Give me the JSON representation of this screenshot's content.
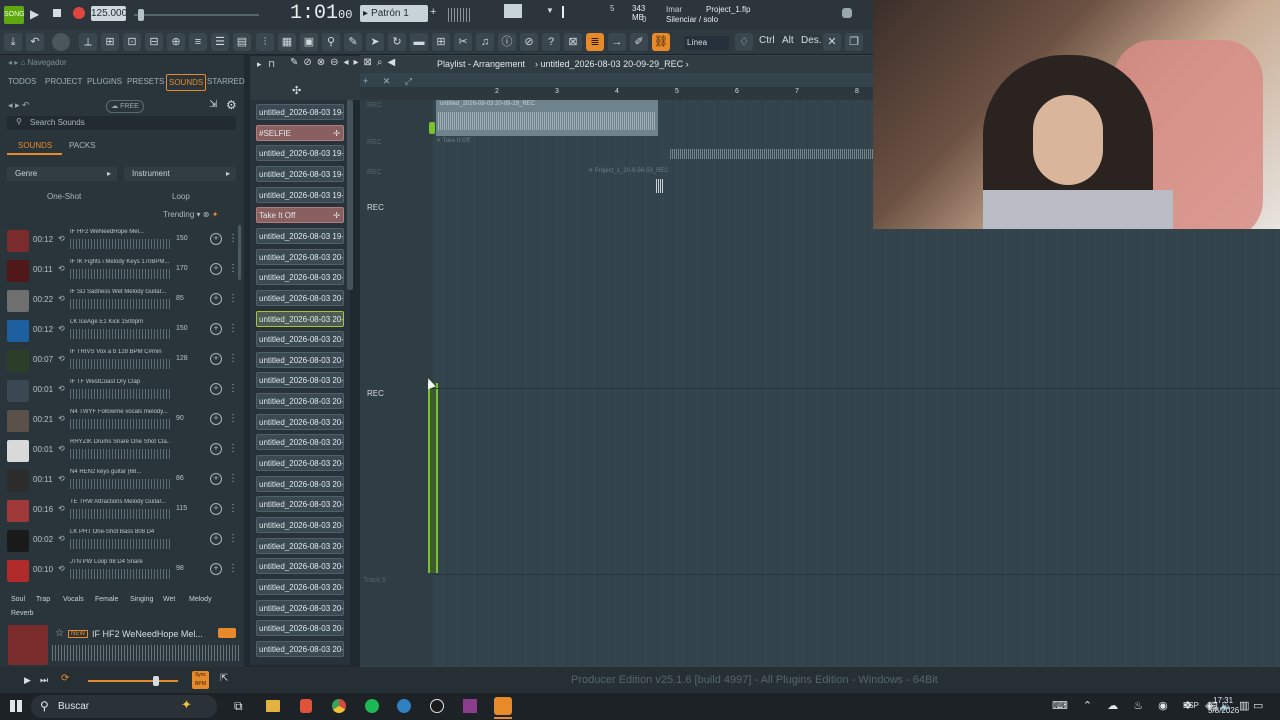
{
  "transport": {
    "tempo": "125.000",
    "time": "1:01",
    "time_sub": "00",
    "pattern": "Patrón 1",
    "cpu_val": "5",
    "mem": "343 MB",
    "mem_sub": "0",
    "project": "Project_1.flp",
    "hint_key": "Imar",
    "hint_text": "Silenciar / solo",
    "line_mode": "Línea",
    "ctrl": "Ctrl",
    "alt": "Alt",
    "des": "Des."
  },
  "browser": {
    "nav_label": "Navegador",
    "tabs": [
      "TODOS",
      "PROJECT",
      "PLUGINS",
      "PRESETS",
      "SOUNDS",
      "STARRED"
    ],
    "free": "FREE",
    "search_placeholder": "Search Sounds",
    "subtabs": [
      "SOUNDS",
      "PACKS"
    ],
    "genre": "Genre",
    "instrument": "Instrument",
    "oneshot": "One-Shot",
    "loop": "Loop",
    "trending": "Trending",
    "sounds": [
      {
        "dur": "00:12",
        "name": "IF HF2 WeNeedHope Mel...",
        "bpm": "150",
        "color": "#7a2b2b"
      },
      {
        "dur": "00:11",
        "name": "IF IK Fights i Melody Keys 170BPM...",
        "bpm": "170",
        "color": "#501818"
      },
      {
        "dur": "00:22",
        "name": "IF SD Sadness Wet Melody Guitar...",
        "bpm": "85",
        "color": "#6f6f6f"
      },
      {
        "dur": "00:12",
        "name": "LK IceAge E1 Kick 150bpm",
        "bpm": "150",
        "color": "#1e5fa0"
      },
      {
        "dur": "00:07",
        "name": "IF TRIVS Vox a b 128 BPM C#min",
        "bpm": "128",
        "color": "#2a3e2a"
      },
      {
        "dur": "00:01",
        "name": "IF TF WestCoast Dry Clap",
        "bpm": "",
        "color": "#3b4852"
      },
      {
        "dur": "00:21",
        "name": "N4 TWYF Followme vocals melody...",
        "bpm": "90",
        "color": "#5a5248"
      },
      {
        "dur": "00:01",
        "name": "RHYZIK Drums Snare One Shot Cla...",
        "bpm": "",
        "color": "#d9d9d9"
      },
      {
        "dur": "00:11",
        "name": "N4 REN2 keys guitar (68...",
        "bpm": "86",
        "color": "#2c2c2c"
      },
      {
        "dur": "00:16",
        "name": "TE TRW Attractions Melody Guitar...",
        "bpm": "115",
        "color": "#a03a3a"
      },
      {
        "dur": "00:02",
        "name": "LK PHT One-Shot Bass 808 D4",
        "bpm": "",
        "color": "#1a1a1a"
      },
      {
        "dur": "00:10",
        "name": "JTN PW Loop 98 D4 Snare",
        "bpm": "98",
        "color": "#b02a2a"
      }
    ],
    "tags": [
      "Soul",
      "Trap",
      "Vocals",
      "Female",
      "Singing",
      "Wet",
      "Melody",
      "Reverb"
    ],
    "preview_title": "IF HF2 WeNeedHope Mel...",
    "preview_badge": "NEW",
    "sync_label": "Sync\nBPM"
  },
  "patterns": [
    "untitled_2026-08-03 19-...",
    "#SELFIE",
    "untitled_2026-08-03 19-...",
    "untitled_2026-08-03 19-...",
    "untitled_2026-08-03 19-...",
    "Take It Off",
    "untitled_2026-08-03 19-...",
    "untitled_2026-08-03 20-...",
    "untitled_2026-08-03 20-...",
    "untitled_2026-08-03 20-...",
    "untitled_2026-08-03 20-...",
    "untitled_2026-08-03 20-...",
    "untitled_2026-08-03 20-...",
    "untitled_2026-08-03 20-...",
    "untitled_2026-08-03 20-...",
    "untitled_2026-08-03 20-...",
    "untitled_2026-08-03 20-...",
    "untitled_2026-08-03 20-...",
    "untitled_2026-08-03 20-...",
    "untitled_2026-08-03 20-...",
    "untitled_2026-08-03 20-...",
    "untitled_2026-08-03 20-...",
    "untitled_2026-08-03 20-...",
    "untitled_2026-08-03 20-...",
    "untitled_2026-08-03 20-...",
    "untitled_2026-08-03 20-...",
    "untitled_2026-08-03 20-..."
  ],
  "playlist": {
    "title": "Playlist - Arrangement",
    "breadcrumb": "untitled_2026-08-03 20-09-29_REC",
    "bars": [
      "2",
      "3",
      "4",
      "5",
      "6",
      "7",
      "8"
    ],
    "clip1": "untitled_2026-08-03 20-09-29_REC",
    "clip2": "Take It Off",
    "clip3": "Project_1_20-8-56-53_REC",
    "rec": "REC",
    "track5": "Track 5"
  },
  "status": "Producer Edition v25.1.6 [build 4997] - All Plugins Edition - Windows - 64Bit",
  "taskbar": {
    "search": "Buscar",
    "lang": "ESP",
    "time": "17:31",
    "date": "5/8/2026"
  }
}
